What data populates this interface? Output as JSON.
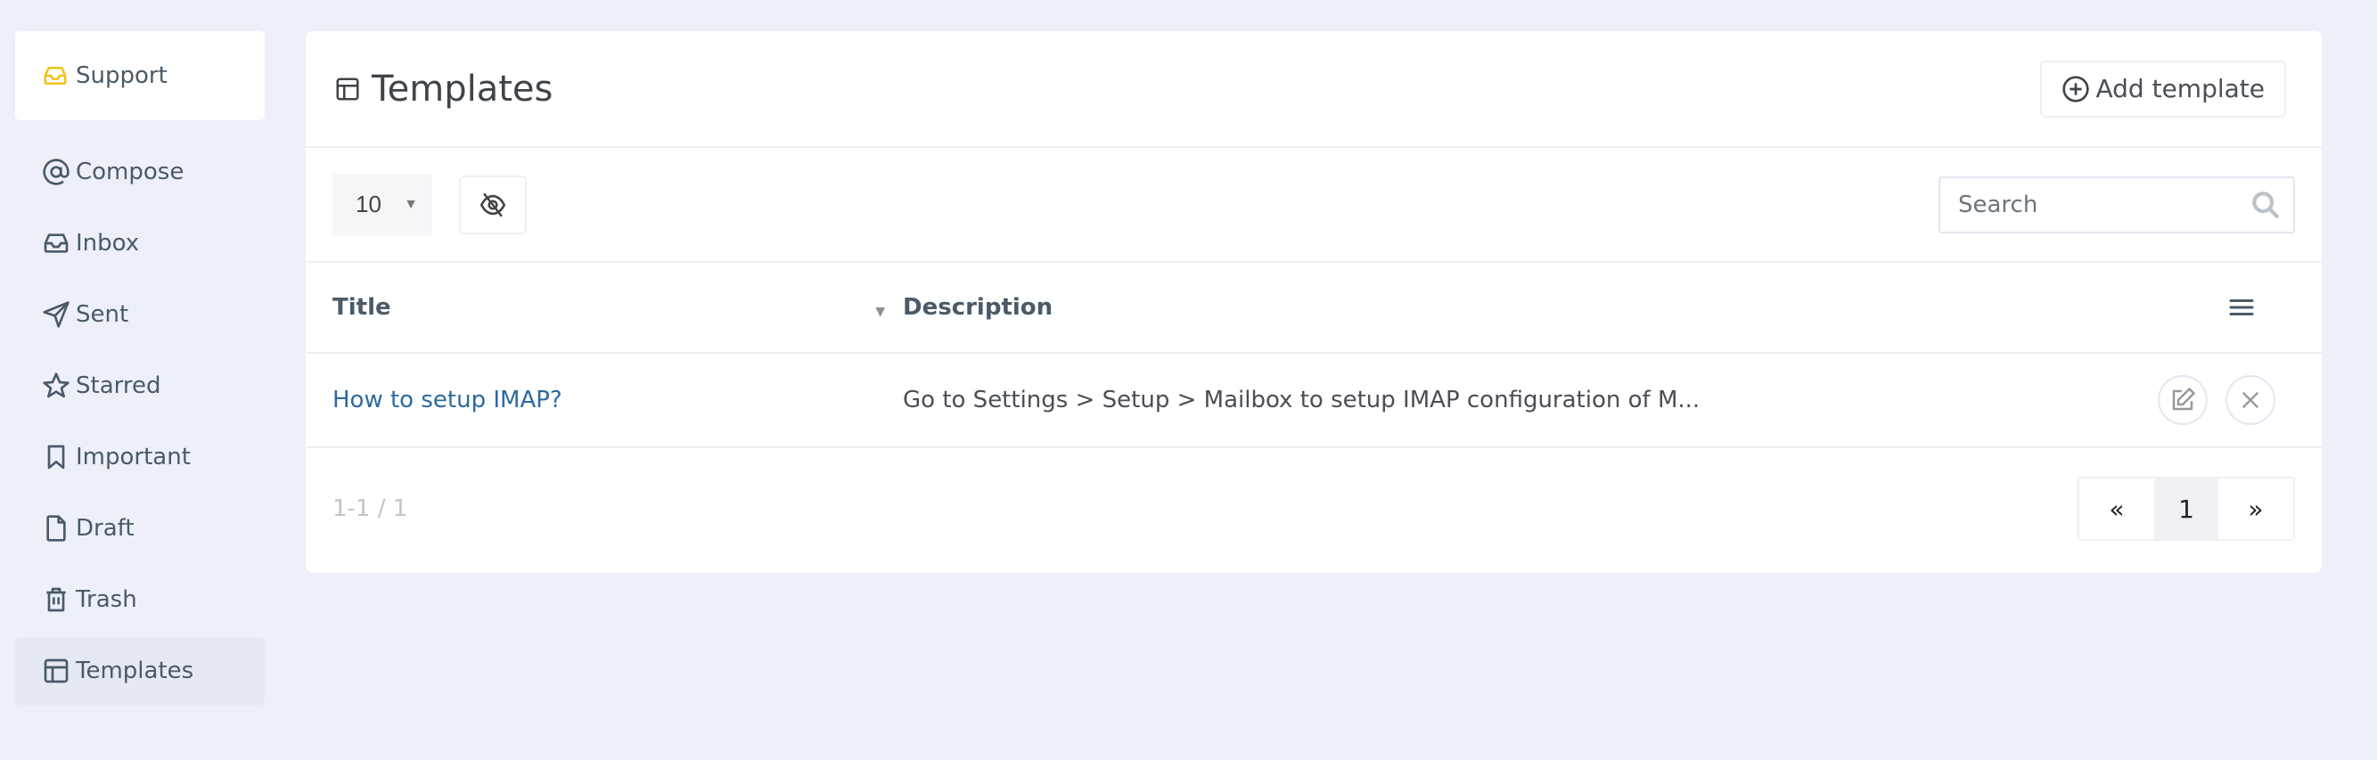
{
  "sidebar": {
    "account": {
      "label": "Support",
      "icon": "inbox-icon",
      "icon_color": "#f0c419"
    },
    "items": [
      {
        "label": "Compose",
        "icon": "at-icon",
        "active": false
      },
      {
        "label": "Inbox",
        "icon": "inbox-icon",
        "active": false
      },
      {
        "label": "Sent",
        "icon": "send-icon",
        "active": false
      },
      {
        "label": "Starred",
        "icon": "star-icon",
        "active": false
      },
      {
        "label": "Important",
        "icon": "bookmark-icon",
        "active": false
      },
      {
        "label": "Draft",
        "icon": "file-icon",
        "active": false
      },
      {
        "label": "Trash",
        "icon": "trash-icon",
        "active": false
      },
      {
        "label": "Templates",
        "icon": "template-icon",
        "active": true
      }
    ]
  },
  "header": {
    "title": "Templates",
    "title_icon": "template-icon",
    "add_button_label": "Add template"
  },
  "toolbar": {
    "per_page_value": "10",
    "column_toggle_icon": "eye-off-icon",
    "search_placeholder": "Search",
    "search_value": ""
  },
  "table": {
    "columns": [
      "Title",
      "Description"
    ],
    "sort_column": "Title",
    "rows": [
      {
        "title": "How to setup IMAP?",
        "description": "Go to Settings > Setup > Mailbox to setup IMAP configuration of M..."
      }
    ]
  },
  "footer": {
    "range_text": "1-1 / 1",
    "prev_label": "«",
    "current_page": "1",
    "next_label": "»"
  },
  "colors": {
    "background": "#edf0f8",
    "accent_link": "#2c6aa0",
    "account_icon": "#f0c419"
  }
}
